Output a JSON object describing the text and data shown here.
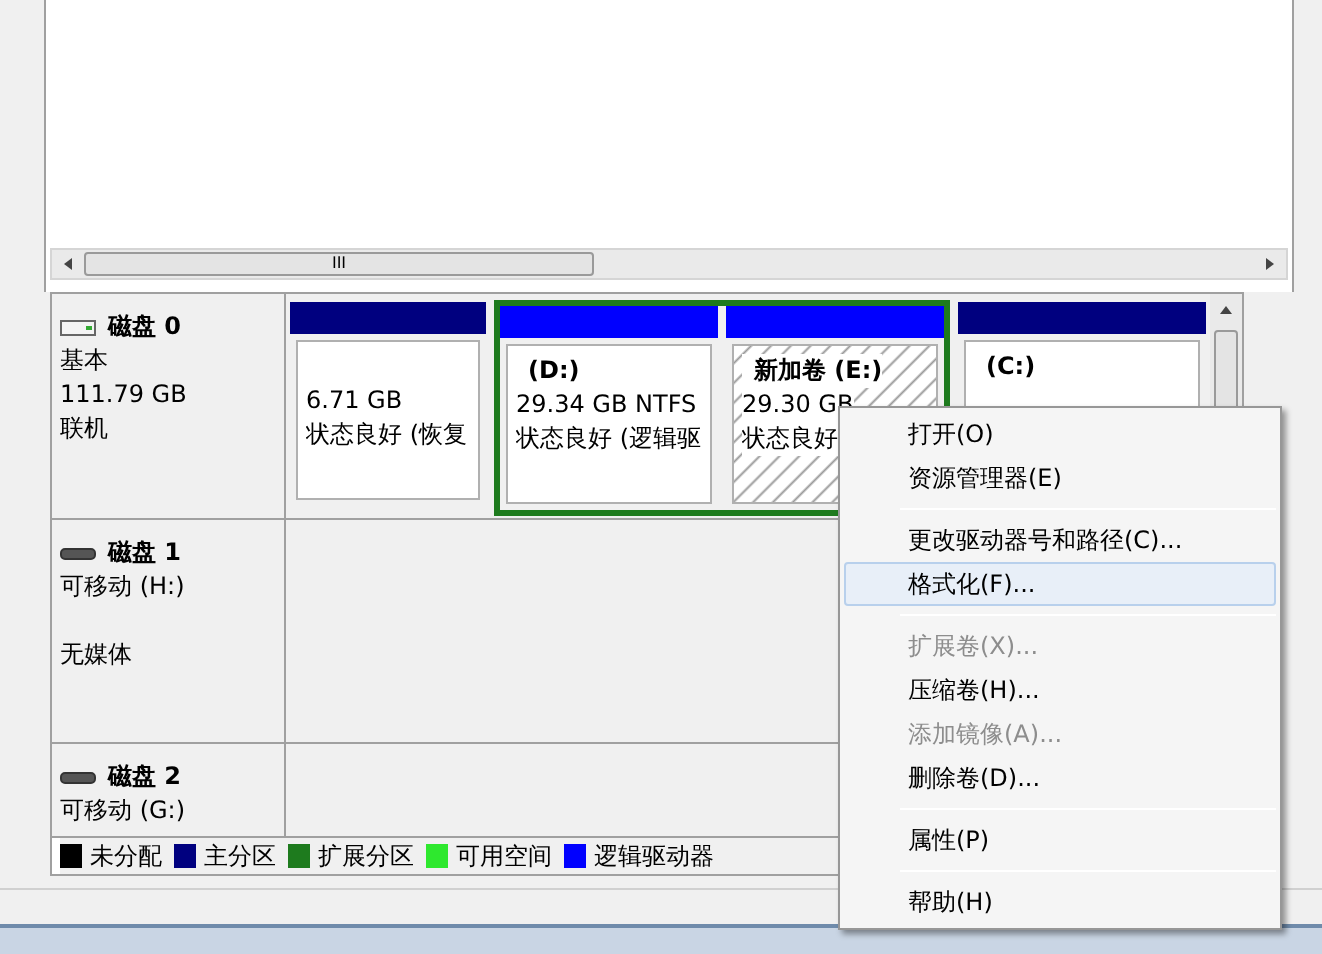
{
  "volume_list": {
    "scrollbar_grip": "III"
  },
  "disks": [
    {
      "name": "磁盘 0",
      "lines": [
        "基本",
        "111.79 GB",
        "联机"
      ],
      "kind": "basic",
      "partitions": [
        {
          "kind": "primary",
          "lines": [
            "6.71 GB",
            "状态良好 (恢复"
          ],
          "selected": false
        },
        {
          "kind": "extended",
          "children": [
            {
              "kind": "logical",
              "title": "(D:)",
              "lines": [
                "29.34 GB NTFS",
                "状态良好 (逻辑驱"
              ],
              "selected": false
            },
            {
              "kind": "logical",
              "title": "新加卷  (E:)",
              "lines": [
                "29.30 GB",
                "状态良好"
              ],
              "selected": true
            }
          ]
        },
        {
          "kind": "primary",
          "title": "(C:)",
          "selected": false
        }
      ]
    },
    {
      "name": "磁盘 1",
      "lines": [
        "可移动 (H:)"
      ],
      "media": "无媒体",
      "kind": "removable"
    },
    {
      "name": "磁盘 2",
      "lines": [
        "可移动 (G:)"
      ],
      "kind": "removable"
    }
  ],
  "legend": [
    {
      "label": "未分配",
      "color": "#000000"
    },
    {
      "label": "主分区",
      "color": "#00007f"
    },
    {
      "label": "扩展分区",
      "color": "#1e7b1e"
    },
    {
      "label": "可用空间",
      "color": "#2ee82e"
    },
    {
      "label": "逻辑驱动器",
      "color": "#0000ff"
    }
  ],
  "context_menu": [
    {
      "kind": "item",
      "label": "打开(O)",
      "disabled": false,
      "selected": false
    },
    {
      "kind": "item",
      "label": "资源管理器(E)",
      "disabled": false,
      "selected": false
    },
    {
      "kind": "separator"
    },
    {
      "kind": "item",
      "label": "更改驱动器号和路径(C)...",
      "disabled": false,
      "selected": false
    },
    {
      "kind": "item",
      "label": "格式化(F)...",
      "disabled": false,
      "selected": true
    },
    {
      "kind": "separator"
    },
    {
      "kind": "item",
      "label": "扩展卷(X)...",
      "disabled": true,
      "selected": false
    },
    {
      "kind": "item",
      "label": "压缩卷(H)...",
      "disabled": false,
      "selected": false
    },
    {
      "kind": "item",
      "label": "添加镜像(A)...",
      "disabled": true,
      "selected": false
    },
    {
      "kind": "item",
      "label": "删除卷(D)...",
      "disabled": false,
      "selected": false
    },
    {
      "kind": "separator"
    },
    {
      "kind": "item",
      "label": "属性(P)",
      "disabled": false,
      "selected": false
    },
    {
      "kind": "separator"
    },
    {
      "kind": "item",
      "label": "帮助(H)",
      "disabled": false,
      "selected": false
    }
  ]
}
